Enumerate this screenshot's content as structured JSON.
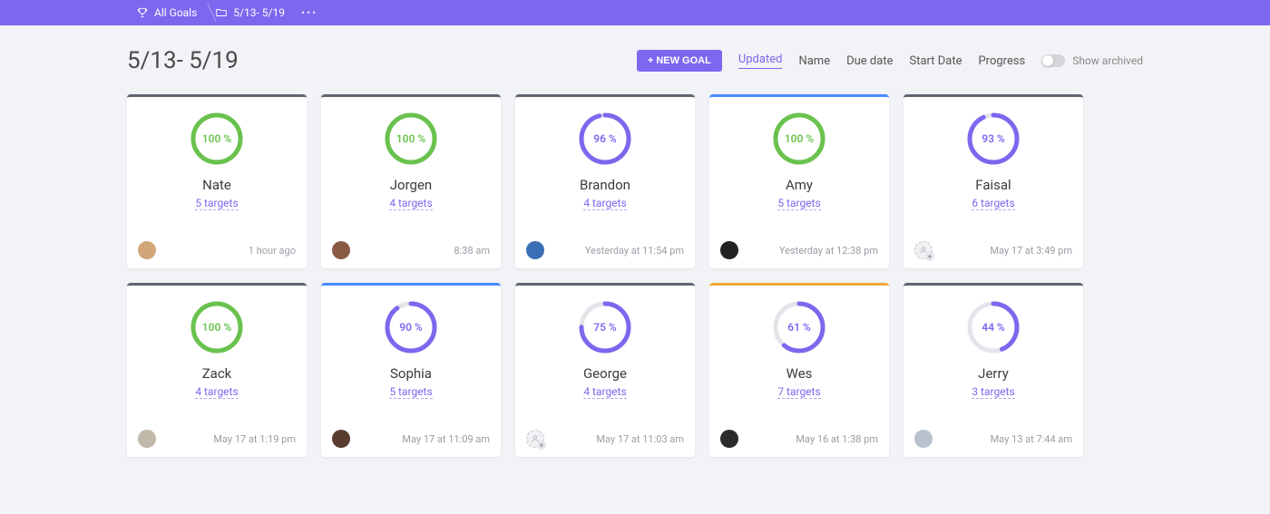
{
  "breadcrumb": {
    "all_goals": "All Goals",
    "current": "5/13- 5/19"
  },
  "page_title": "5/13- 5/19",
  "header": {
    "new_goal_label": "+ NEW GOAL",
    "sort_options": [
      "Updated",
      "Name",
      "Due date",
      "Start Date",
      "Progress"
    ],
    "active_sort": "Updated",
    "show_archived_label": "Show archived"
  },
  "cards": [
    {
      "name": "Nate",
      "percent": 100,
      "ring_color": "green",
      "bar_color": "",
      "targets": "5 targets",
      "timestamp": "1 hour ago",
      "avatar_bg": "#d2a679"
    },
    {
      "name": "Jorgen",
      "percent": 100,
      "ring_color": "green",
      "bar_color": "",
      "targets": "4 targets",
      "timestamp": "8:38 am",
      "avatar_bg": "#8b5a44"
    },
    {
      "name": "Brandon",
      "percent": 96,
      "ring_color": "purple",
      "bar_color": "",
      "targets": "4 targets",
      "timestamp": "Yesterday at 11:54 pm",
      "avatar_bg": "#3b6fb5"
    },
    {
      "name": "Amy",
      "percent": 100,
      "ring_color": "green",
      "bar_color": "blue",
      "targets": "5 targets",
      "timestamp": "Yesterday at 12:38 pm",
      "avatar_bg": "#222"
    },
    {
      "name": "Faisal",
      "percent": 93,
      "ring_color": "purple",
      "bar_color": "",
      "targets": "6 targets",
      "timestamp": "May 17 at 3:49 pm",
      "avatar_bg": ""
    },
    {
      "name": "Zack",
      "percent": 100,
      "ring_color": "green",
      "bar_color": "",
      "targets": "4 targets",
      "timestamp": "May 17 at 1:19 pm",
      "avatar_bg": "#c0b8a8"
    },
    {
      "name": "Sophia",
      "percent": 90,
      "ring_color": "purple",
      "bar_color": "blue",
      "targets": "5 targets",
      "timestamp": "May 17 at 11:09 am",
      "avatar_bg": "#5a3c2e"
    },
    {
      "name": "George",
      "percent": 75,
      "ring_color": "purple",
      "bar_color": "",
      "targets": "4 targets",
      "timestamp": "May 17 at 11:03 am",
      "avatar_bg": ""
    },
    {
      "name": "Wes",
      "percent": 61,
      "ring_color": "purple",
      "bar_color": "orange",
      "targets": "7 targets",
      "timestamp": "May 16 at 1:38 pm",
      "avatar_bg": "#2b2b2b"
    },
    {
      "name": "Jerry",
      "percent": 44,
      "ring_color": "purple",
      "bar_color": "",
      "targets": "3 targets",
      "timestamp": "May 13 at 7:44 am",
      "avatar_bg": "#b9c2cc"
    }
  ]
}
